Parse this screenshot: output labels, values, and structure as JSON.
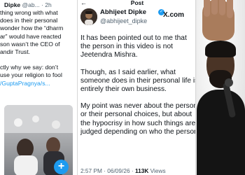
{
  "left_tweet": {
    "name": "Dipke",
    "meta": "@ab... · 2h",
    "lines": [
      "thing wrong with what",
      "does in their personal",
      "wonder how the “dharm",
      "ar” would have reacted",
      "son wasn’t the CEO of",
      "andir Trust.",
      "",
      "ctly why we say: don’t",
      "use your religion to fool",
      "/GuptaPragnya/s..."
    ],
    "fab_label": "+"
  },
  "main_tweet": {
    "header_title": "Post",
    "back_icon": "←",
    "author_name": "Abhijeet Dipke",
    "author_handle": "@abhijeet_dipke",
    "source": "X.com",
    "paragraph1": [
      "It has been pointed out to me that",
      "the person in this video is not",
      "Jeetendra Mishra."
    ],
    "paragraph2": [
      "Though, as I said earlier, what",
      "someone does in their personal life is",
      "entirely their own business."
    ],
    "paragraph3": [
      "My point was never about the person",
      "or their personal choices, but about",
      "the hypocrisy in how such things are",
      "judged depending on who the person is."
    ],
    "timestamp": "2:57 PM · 06/09/26 ·",
    "views_count": "113K",
    "views_label": "Views"
  },
  "colors": {
    "accent": "#1d9bf0",
    "text": "#0f1419",
    "muted": "#536471"
  }
}
